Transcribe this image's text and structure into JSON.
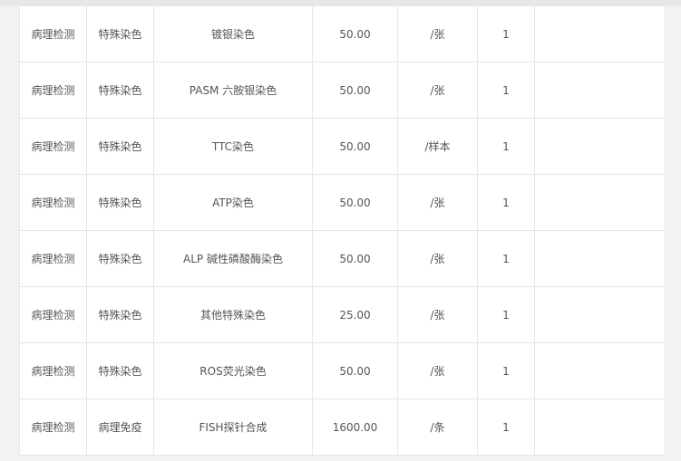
{
  "rows": [
    {
      "category": "病理检测",
      "subcategory": "特殊染色",
      "item": "镀银染色",
      "price": "50.00",
      "unit": "/张",
      "qty": "1",
      "note": ""
    },
    {
      "category": "病理检测",
      "subcategory": "特殊染色",
      "item": "PASM 六胺银染色",
      "price": "50.00",
      "unit": "/张",
      "qty": "1",
      "note": ""
    },
    {
      "category": "病理检测",
      "subcategory": "特殊染色",
      "item": "TTC染色",
      "price": "50.00",
      "unit": "/样本",
      "qty": "1",
      "note": ""
    },
    {
      "category": "病理检测",
      "subcategory": "特殊染色",
      "item": "ATP染色",
      "price": "50.00",
      "unit": "/张",
      "qty": "1",
      "note": ""
    },
    {
      "category": "病理检测",
      "subcategory": "特殊染色",
      "item": "ALP 碱性磷酸酶染色",
      "price": "50.00",
      "unit": "/张",
      "qty": "1",
      "note": ""
    },
    {
      "category": "病理检测",
      "subcategory": "特殊染色",
      "item": "其他特殊染色",
      "price": "25.00",
      "unit": "/张",
      "qty": "1",
      "note": ""
    },
    {
      "category": "病理检测",
      "subcategory": "特殊染色",
      "item": "ROS荧光染色",
      "price": "50.00",
      "unit": "/张",
      "qty": "1",
      "note": ""
    },
    {
      "category": "病理检测",
      "subcategory": "病理免疫",
      "item": "FISH探针合成",
      "price": "1600.00",
      "unit": "/条",
      "qty": "1",
      "note": ""
    }
  ]
}
